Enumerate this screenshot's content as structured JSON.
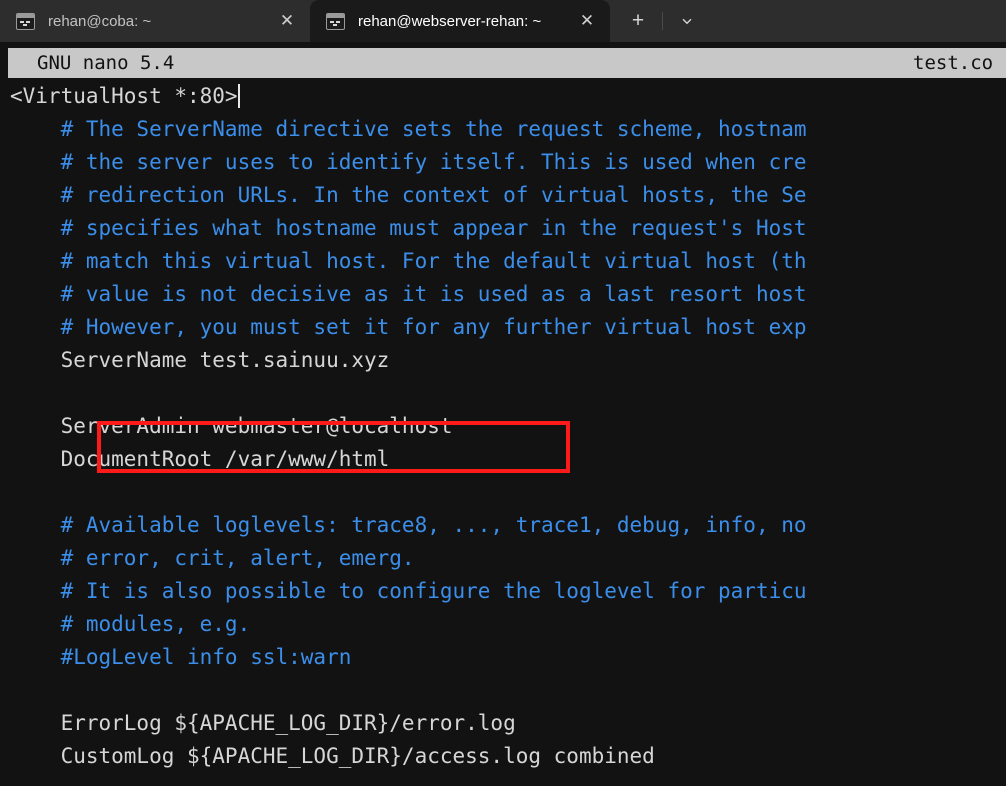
{
  "window": {
    "tabs": [
      {
        "title": "rehan@coba: ~",
        "icon": "terminal-icon",
        "close_label": "✕",
        "active": false
      },
      {
        "title": "rehan@webserver-rehan: ~",
        "icon": "terminal-icon",
        "close_label": "✕",
        "active": true
      }
    ],
    "new_tab_label": "+",
    "dropdown_label": "chevron-down-icon"
  },
  "nano": {
    "version_label": "GNU nano 5.4",
    "filename_label": "test.co"
  },
  "editor": {
    "lines": [
      {
        "text": "<VirtualHost *:80>",
        "comment": false,
        "cursor": true
      },
      {
        "text": "    # The ServerName directive sets the request scheme, hostnam",
        "comment": true,
        "cursor": false
      },
      {
        "text": "    # the server uses to identify itself. This is used when cre",
        "comment": true,
        "cursor": false
      },
      {
        "text": "    # redirection URLs. In the context of virtual hosts, the Se",
        "comment": true,
        "cursor": false
      },
      {
        "text": "    # specifies what hostname must appear in the request's Host",
        "comment": true,
        "cursor": false
      },
      {
        "text": "    # match this virtual host. For the default virtual host (th",
        "comment": true,
        "cursor": false
      },
      {
        "text": "    # value is not decisive as it is used as a last resort host",
        "comment": true,
        "cursor": false
      },
      {
        "text": "    # However, you must set it for any further virtual host exp",
        "comment": true,
        "cursor": false
      },
      {
        "text": "    ServerName test.sainuu.xyz",
        "comment": false,
        "cursor": false
      },
      {
        "text": "",
        "comment": false,
        "cursor": false
      },
      {
        "text": "    ServerAdmin webmaster@localhost",
        "comment": false,
        "cursor": false
      },
      {
        "text": "    DocumentRoot /var/www/html",
        "comment": false,
        "cursor": false
      },
      {
        "text": "",
        "comment": false,
        "cursor": false
      },
      {
        "text": "    # Available loglevels: trace8, ..., trace1, debug, info, no",
        "comment": true,
        "cursor": false
      },
      {
        "text": "    # error, crit, alert, emerg.",
        "comment": true,
        "cursor": false
      },
      {
        "text": "    # It is also possible to configure the loglevel for particu",
        "comment": true,
        "cursor": false
      },
      {
        "text": "    # modules, e.g.",
        "comment": true,
        "cursor": false
      },
      {
        "text": "    #LogLevel info ssl:warn",
        "comment": true,
        "cursor": false
      },
      {
        "text": "",
        "comment": false,
        "cursor": false
      },
      {
        "text": "    ErrorLog ${APACHE_LOG_DIR}/error.log",
        "comment": false,
        "cursor": false
      },
      {
        "text": "    CustomLog ${APACHE_LOG_DIR}/access.log combined",
        "comment": false,
        "cursor": false
      }
    ]
  },
  "annotation": {
    "highlight_color": "#ff1a1a",
    "highlighted_text": "ServerName test.sainuu.xyz"
  },
  "colors": {
    "background": "#121212",
    "comment": "#3b8eea",
    "text": "#d6d6d6",
    "titlebar_bg": "#c8c8c8",
    "tabbar_bg": "#2d2d2d",
    "active_tab_bg": "#1a1a1a"
  }
}
